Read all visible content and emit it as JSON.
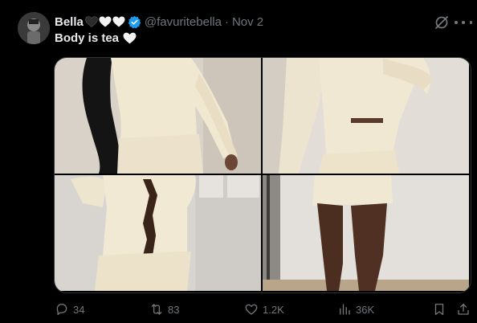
{
  "post": {
    "display_name": "Bella",
    "name_hearts": [
      "black-heart-emoji",
      "white-heart-emoji",
      "white-heart-emoji"
    ],
    "verified": true,
    "handle": "@favuritebella",
    "separator": "·",
    "date": "Nov 2",
    "text": "Body is tea",
    "text_emoji": "white-heart-emoji"
  },
  "media": {
    "photos": [
      {
        "index": 1,
        "description": "cream knit outfit, side view"
      },
      {
        "index": 2,
        "description": "cream knit outfit, back view"
      },
      {
        "index": 3,
        "description": "cream knit outfit, front torso"
      },
      {
        "index": 4,
        "description": "cream knit skirt, legs"
      }
    ]
  },
  "actions": {
    "replies": "34",
    "reposts": "83",
    "likes": "1.2K",
    "views": "36K"
  },
  "icons": [
    "grok-icon",
    "more-icon",
    "reply-icon",
    "repost-icon",
    "like-icon",
    "views-icon",
    "bookmark-icon",
    "share-icon",
    "verified-badge-icon"
  ],
  "colors": {
    "background": "#000000",
    "text_primary": "#e7e9ea",
    "text_secondary": "#71767b",
    "verified_blue": "#1d9bf0"
  }
}
